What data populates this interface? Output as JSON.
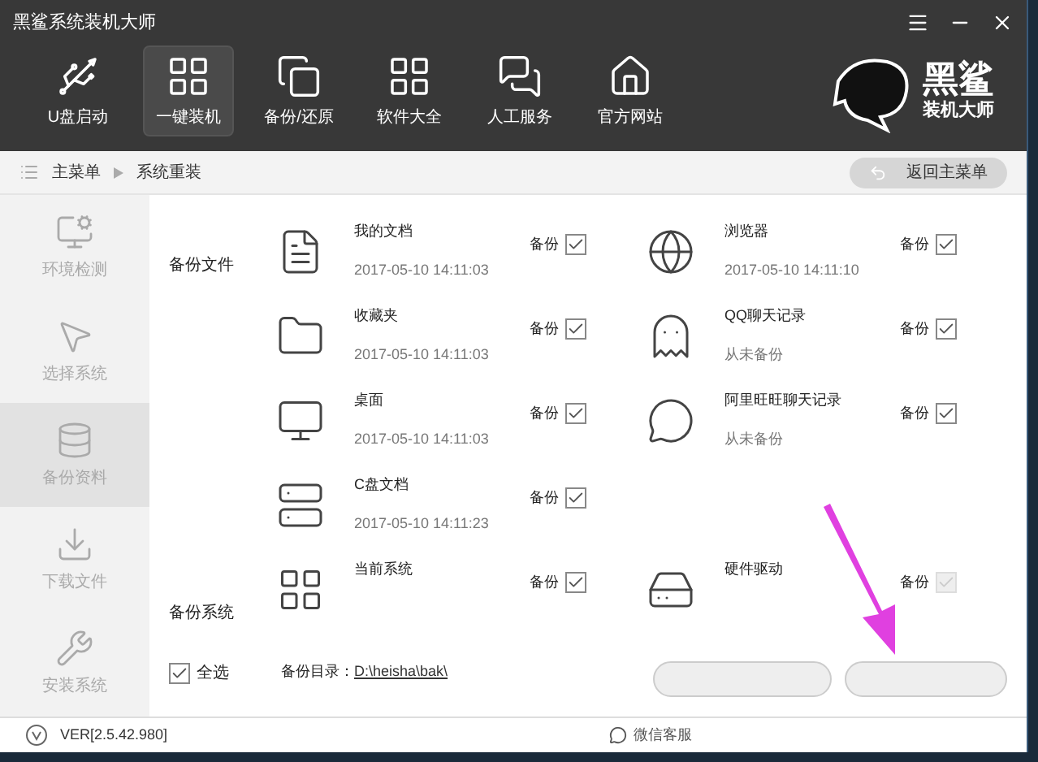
{
  "window": {
    "title": "黑鲨系统装机大师"
  },
  "nav": [
    {
      "label": "U盘启动",
      "selected": false
    },
    {
      "label": "一键装机",
      "selected": true
    },
    {
      "label": "备份/还原",
      "selected": false
    },
    {
      "label": "软件大全",
      "selected": false
    },
    {
      "label": "人工服务",
      "selected": false
    },
    {
      "label": "官方网站",
      "selected": false
    }
  ],
  "logo": {
    "line1": "黑鲨",
    "line2": "装机大师"
  },
  "breadcrumb": [
    "主菜单",
    "系统重装"
  ],
  "back_button": "返回主菜单",
  "sidebar": [
    {
      "label": "环境检测",
      "selected": false
    },
    {
      "label": "选择系统",
      "selected": false
    },
    {
      "label": "备份资料",
      "selected": true
    },
    {
      "label": "下载文件",
      "selected": false
    },
    {
      "label": "安装系统",
      "selected": false
    }
  ],
  "sections": [
    {
      "label": "备份文件",
      "items": [
        {
          "name": "我的文档",
          "detail": "2017-05-10 14:11:03",
          "check_label": "备份",
          "checked": true,
          "disabled": false
        },
        {
          "name": "浏览器",
          "detail": "2017-05-10 14:11:10",
          "check_label": "备份",
          "checked": true,
          "disabled": false
        },
        {
          "name": "收藏夹",
          "detail": "2017-05-10 14:11:03",
          "check_label": "备份",
          "checked": true,
          "disabled": false
        },
        {
          "name": "QQ聊天记录",
          "detail": "从未备份",
          "check_label": "备份",
          "checked": true,
          "disabled": false
        },
        {
          "name": "桌面",
          "detail": "2017-05-10 14:11:03",
          "check_label": "备份",
          "checked": true,
          "disabled": false
        },
        {
          "name": "阿里旺旺聊天记录",
          "detail": "从未备份",
          "check_label": "备份",
          "checked": true,
          "disabled": false
        },
        {
          "name": "C盘文档",
          "detail": "2017-05-10 14:11:23",
          "check_label": "备份",
          "checked": true,
          "disabled": false
        }
      ]
    },
    {
      "label": "备份系统",
      "items": [
        {
          "name": "当前系统",
          "check_label": "备份",
          "checked": true,
          "disabled": false
        },
        {
          "name": "硬件驱动",
          "check_label": "备份",
          "checked": true,
          "disabled": true
        }
      ]
    }
  ],
  "select_all": {
    "label": "全选",
    "checked": true
  },
  "backup_dir": {
    "label": "备份目录：",
    "path": "D:\\heisha\\bak\\"
  },
  "footer": {
    "version": "VER[2.5.42.980]",
    "links": [
      "微信客服"
    ]
  }
}
